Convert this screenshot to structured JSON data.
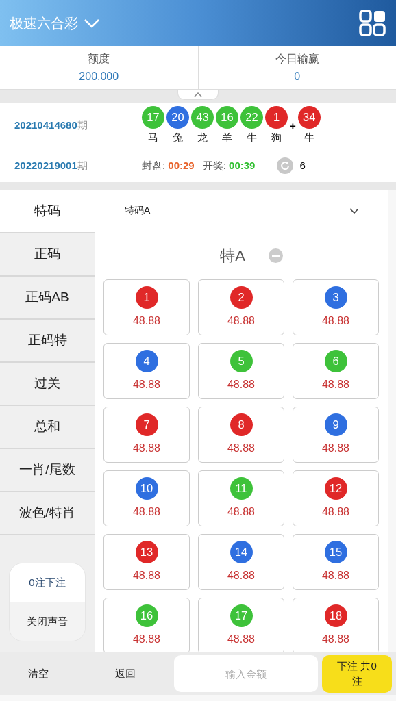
{
  "header": {
    "title": "极速六合彩"
  },
  "stats": [
    {
      "label": "额度",
      "value": "200.000"
    },
    {
      "label": "今日输赢",
      "value": "0"
    }
  ],
  "last_draw": {
    "issue": "20210414680",
    "suffix": "期",
    "balls": [
      {
        "number": "17",
        "zodiac": "马",
        "color": "#3ec23a"
      },
      {
        "number": "20",
        "zodiac": "兔",
        "color": "#2f6fe0"
      },
      {
        "number": "43",
        "zodiac": "龙",
        "color": "#3ec23a"
      },
      {
        "number": "16",
        "zodiac": "羊",
        "color": "#3ec23a"
      },
      {
        "number": "22",
        "zodiac": "牛",
        "color": "#3ec23a"
      },
      {
        "number": "1",
        "zodiac": "狗",
        "color": "#e02828"
      }
    ],
    "plus": "+",
    "special": {
      "number": "34",
      "zodiac": "牛",
      "color": "#e02828"
    }
  },
  "next_draw": {
    "issue": "20220219001",
    "suffix": "期",
    "close_label": "封盘:",
    "close_time": "00:29",
    "open_label": "开奖:",
    "open_time": "00:39",
    "refresh_count": "6"
  },
  "sidebar": {
    "items": [
      {
        "label": "特码",
        "selected": true
      },
      {
        "label": "正码",
        "selected": false
      },
      {
        "label": "正码AB",
        "selected": false
      },
      {
        "label": "正码特",
        "selected": false
      },
      {
        "label": "过关",
        "selected": false
      },
      {
        "label": "总和",
        "selected": false
      },
      {
        "label": "一肖/尾数",
        "selected": false
      },
      {
        "label": "波色/特肖",
        "selected": false
      }
    ],
    "bet_count": "0注下注",
    "sound": "关闭声音"
  },
  "dropdown": {
    "value": "特码A"
  },
  "section_title": "特A",
  "numbers": [
    {
      "number": "1",
      "odds": "48.88",
      "color": "#e02828"
    },
    {
      "number": "2",
      "odds": "48.88",
      "color": "#e02828"
    },
    {
      "number": "3",
      "odds": "48.88",
      "color": "#2f6fe0"
    },
    {
      "number": "4",
      "odds": "48.88",
      "color": "#2f6fe0"
    },
    {
      "number": "5",
      "odds": "48.88",
      "color": "#3ec23a"
    },
    {
      "number": "6",
      "odds": "48.88",
      "color": "#3ec23a"
    },
    {
      "number": "7",
      "odds": "48.88",
      "color": "#e02828"
    },
    {
      "number": "8",
      "odds": "48.88",
      "color": "#e02828"
    },
    {
      "number": "9",
      "odds": "48.88",
      "color": "#2f6fe0"
    },
    {
      "number": "10",
      "odds": "48.88",
      "color": "#2f6fe0"
    },
    {
      "number": "11",
      "odds": "48.88",
      "color": "#3ec23a"
    },
    {
      "number": "12",
      "odds": "48.88",
      "color": "#e02828"
    },
    {
      "number": "13",
      "odds": "48.88",
      "color": "#e02828"
    },
    {
      "number": "14",
      "odds": "48.88",
      "color": "#2f6fe0"
    },
    {
      "number": "15",
      "odds": "48.88",
      "color": "#2f6fe0"
    },
    {
      "number": "16",
      "odds": "48.88",
      "color": "#3ec23a"
    },
    {
      "number": "17",
      "odds": "48.88",
      "color": "#3ec23a"
    },
    {
      "number": "18",
      "odds": "48.88",
      "color": "#e02828"
    }
  ],
  "bottom_bar": {
    "clear": "清空",
    "back": "返回",
    "amount_placeholder": "输入金额",
    "submit": "下注 共0注"
  }
}
